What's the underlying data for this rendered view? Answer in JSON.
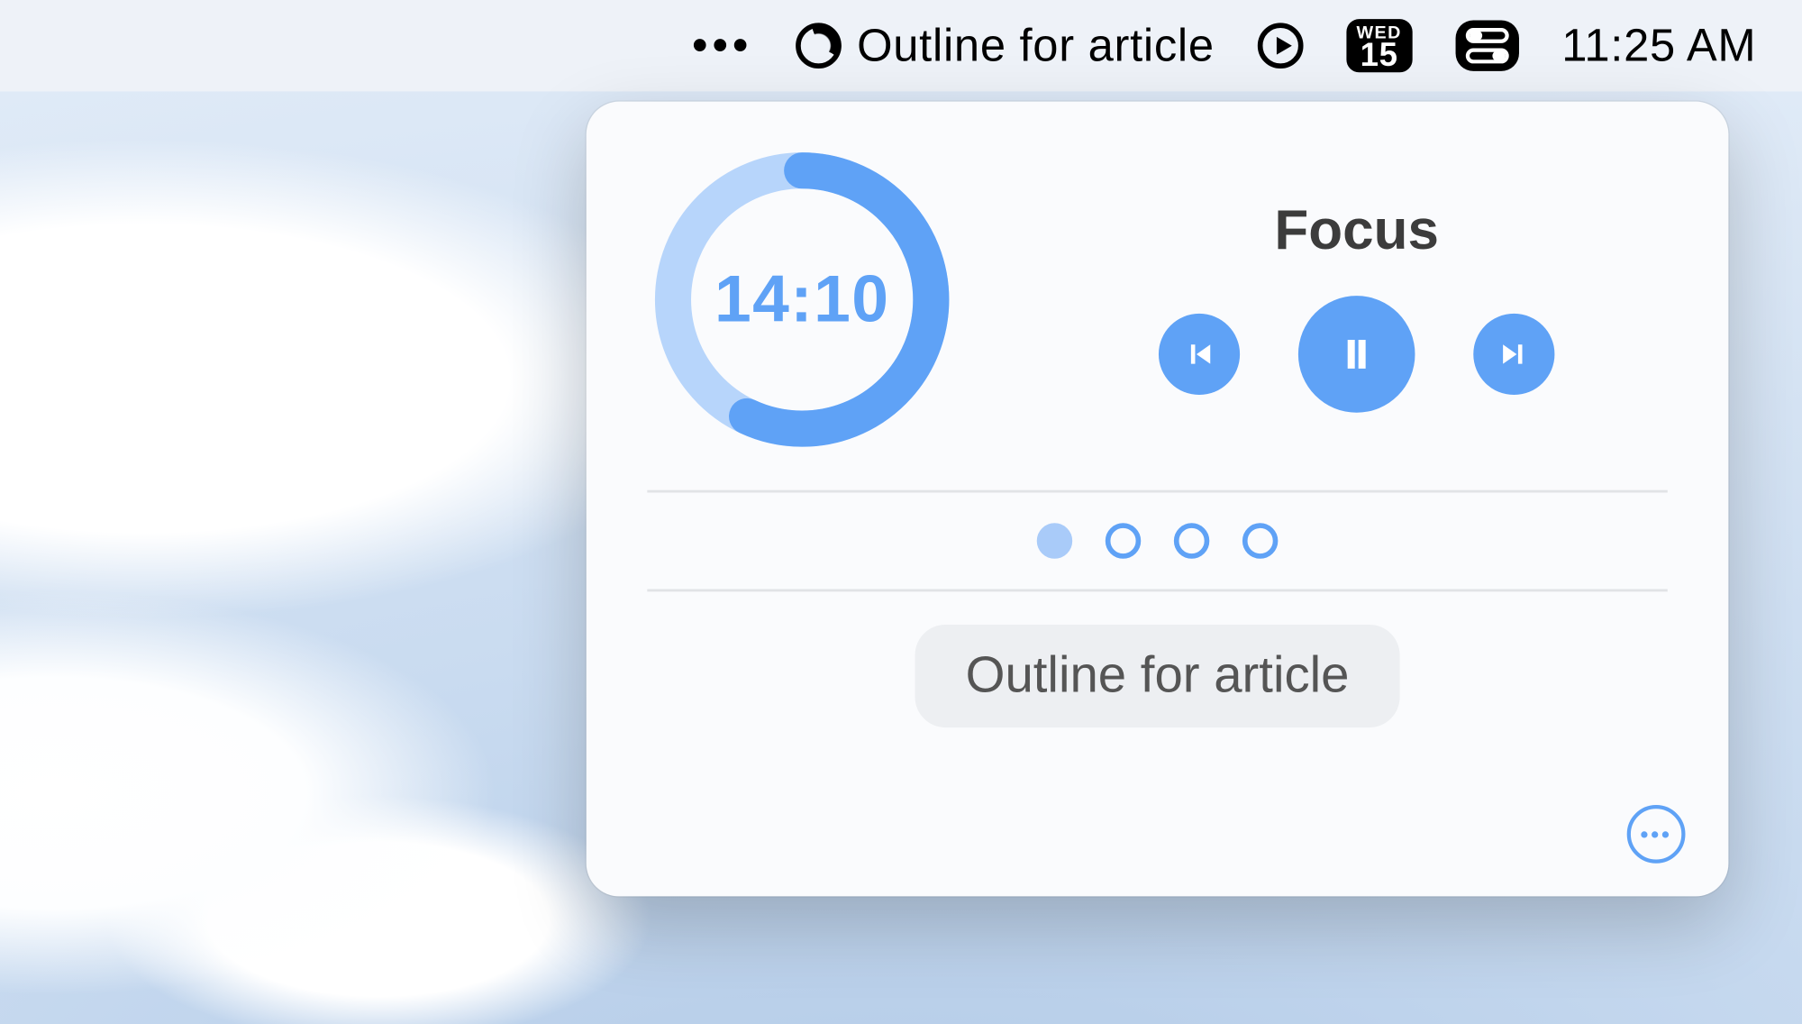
{
  "menubar": {
    "task_title": "Outline for article",
    "calendar": {
      "dow": "WED",
      "day": "15"
    },
    "clock": "11:25 AM"
  },
  "panel": {
    "timer": {
      "remaining": "14:10",
      "progress_pct": 57,
      "mode_label": "Focus"
    },
    "sessions": {
      "total": 4,
      "current": 1
    },
    "task_name": "Outline for article"
  },
  "colors": {
    "accent": "#5FA2F6",
    "accent_light": "#B7D5FB"
  }
}
